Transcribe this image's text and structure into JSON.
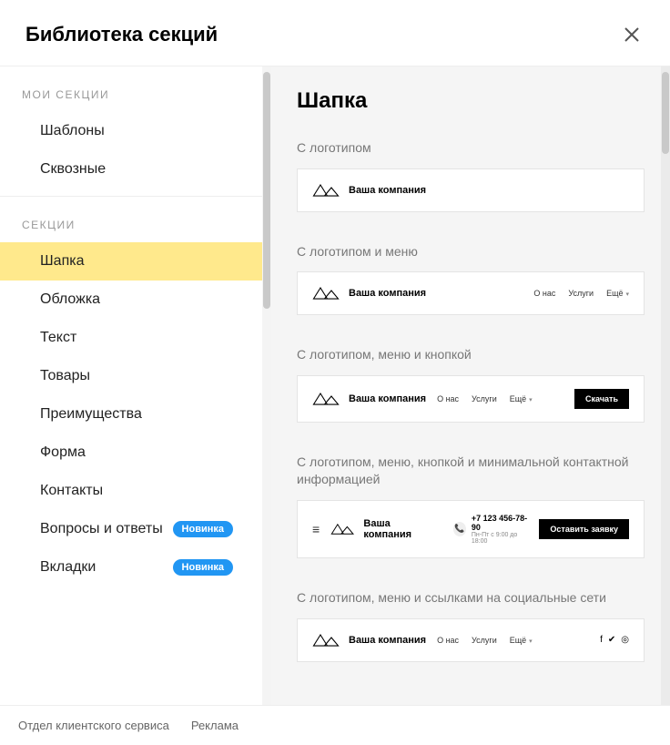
{
  "header": {
    "title": "Библиотека секций"
  },
  "sidebar": {
    "group1_label": "МОИ СЕКЦИИ",
    "group1_items": [
      {
        "label": "Шаблоны"
      },
      {
        "label": "Сквозные"
      }
    ],
    "group2_label": "СЕКЦИИ",
    "group2_items": [
      {
        "label": "Шапка",
        "active": true
      },
      {
        "label": "Обложка"
      },
      {
        "label": "Текст"
      },
      {
        "label": "Товары"
      },
      {
        "label": "Преимущества"
      },
      {
        "label": "Форма"
      },
      {
        "label": "Контакты"
      },
      {
        "label": "Вопросы и ответы",
        "badge": "Новинка"
      },
      {
        "label": "Вкладки",
        "badge": "Новинка"
      }
    ]
  },
  "content": {
    "title": "Шапка",
    "sections": [
      {
        "label": "С логотипом"
      },
      {
        "label": "С логотипом и меню"
      },
      {
        "label": "С логотипом, меню и кнопкой"
      },
      {
        "label": "С логотипом, меню, кнопкой и минимальной контактной информацией"
      },
      {
        "label": "С логотипом, меню и ссылками на социальные сети"
      }
    ],
    "preview": {
      "company": "Ваша компания",
      "nav": {
        "about": "О нас",
        "services": "Услуги",
        "more": "Ещё"
      },
      "btn_download": "Скачать",
      "btn_request": "Оставить заявку",
      "phone": "+7 123 456-78-90",
      "hours": "Пн-Пт с 9:00 до 18:00"
    }
  },
  "footer": {
    "link1": "Отдел клиентского сервиса",
    "link2": "Реклама"
  }
}
